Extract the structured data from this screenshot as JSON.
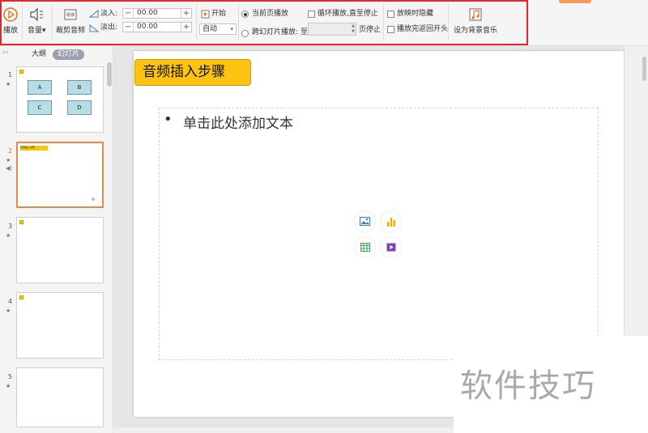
{
  "ribbon": {
    "play_label": "播放",
    "volume_label": "音量",
    "trim_label": "裁剪音频",
    "fade_in_label": "淡入:",
    "fade_in_value": "00.00",
    "fade_out_label": "淡出:",
    "fade_out_value": "00.00",
    "start_label": "开始",
    "start_mode": "自动",
    "current_page_label": "当前页播放",
    "cross_slide_label": "跨幻灯片播放: 至",
    "page_stop_label": "页停止",
    "loop_label": "循环播放,直至停止",
    "hide_label": "放映时隐藏",
    "rewind_label": "播放完返回开头",
    "bg_music_label": "设为背景音乐"
  },
  "panel": {
    "outline_tab": "大纲",
    "slides_tab": "幻灯片",
    "thumbs": [
      {
        "num": "1",
        "boxes": [
          "A",
          "B",
          "C",
          "D"
        ]
      },
      {
        "num": "2",
        "title": "音频插入步骤"
      },
      {
        "num": "3"
      },
      {
        "num": "4"
      },
      {
        "num": "5"
      }
    ]
  },
  "slide": {
    "title": "音频插入步骤",
    "bullet": "•",
    "placeholder_text": "单击此处添加文本"
  },
  "watermark": "软件技巧",
  "colors": {
    "highlight": "#e0282f",
    "title_fill": "#fcc313",
    "selected_border": "#e58a4d"
  }
}
